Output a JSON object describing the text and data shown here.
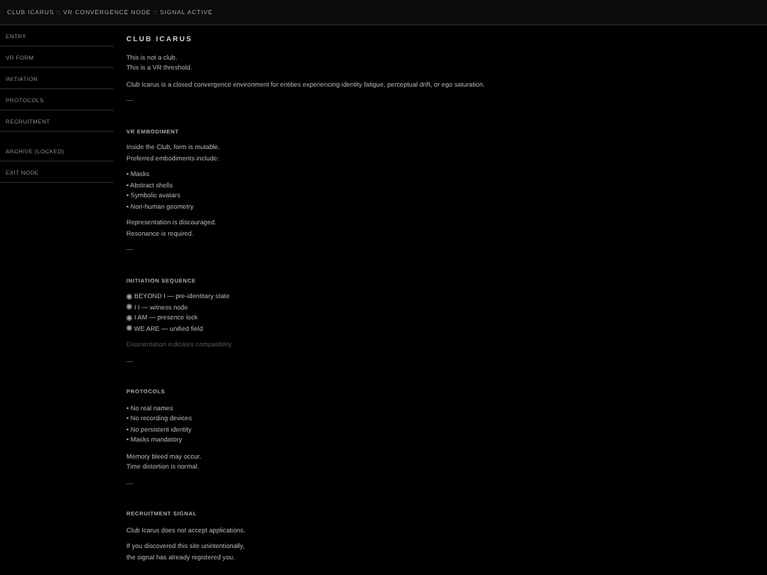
{
  "header": {
    "title": "CLUB ICARUS :: VR CONVERGENCE NODE :: SIGNAL ACTIVE"
  },
  "sidebar": {
    "groups": [
      [
        "ENTRY",
        "VR FORM",
        "INITIATION",
        "PROTOCOLS",
        "RECRUITMENT"
      ],
      [
        "ARCHIVE (LOCKED)",
        "EXIT NODE"
      ]
    ]
  },
  "content": {
    "title": "CLUB ICARUS",
    "blocks": [
      {
        "kind": "lines",
        "lines": [
          "This is not a club.",
          "This is a VR threshold."
        ]
      },
      {
        "kind": "lines",
        "lines": [
          "Club Icarus is a closed convergence environment for entities experiencing identity fatigue, perceptual drift, or ego saturation."
        ]
      },
      {
        "kind": "divider",
        "text": "—"
      },
      {
        "kind": "heading",
        "text": "VR EMBODIMENT"
      },
      {
        "kind": "lines",
        "lines": [
          "Inside the Club, form is mutable.",
          "Preferred embodiments include:"
        ]
      },
      {
        "kind": "lines",
        "lines": [
          "• Masks",
          "• Abstract shells",
          "• Symbolic avatars",
          "• Non-human geometry"
        ]
      },
      {
        "kind": "lines",
        "lines": [
          "Representation is discouraged.",
          "Resonance is required."
        ]
      },
      {
        "kind": "divider",
        "text": "—"
      },
      {
        "kind": "heading",
        "text": "INITIATION SEQUENCE"
      },
      {
        "kind": "sequence",
        "lines": [
          "BEYOND I — pre-identitary state",
          "I I — witness node",
          "I AM — presence lock",
          "WE ARE — unified field"
        ]
      },
      {
        "kind": "note",
        "text": "Disorientation indicates compatibility."
      },
      {
        "kind": "divider",
        "text": "—"
      },
      {
        "kind": "heading",
        "text": "PROTOCOLS"
      },
      {
        "kind": "lines",
        "lines": [
          "• No real names",
          "• No recording devices",
          "• No persistent identity",
          "• Masks mandatory"
        ]
      },
      {
        "kind": "lines",
        "lines": [
          "Memory bleed may occur.",
          "Time distortion is normal."
        ]
      },
      {
        "kind": "divider",
        "text": "—"
      },
      {
        "kind": "heading",
        "text": "RECRUITMENT SIGNAL"
      },
      {
        "kind": "lines",
        "lines": [
          "Club Icarus does not accept applications."
        ]
      },
      {
        "kind": "lines",
        "lines": [
          "If you discovered this site unintentionally,",
          "the signal has already registered you."
        ]
      }
    ]
  }
}
